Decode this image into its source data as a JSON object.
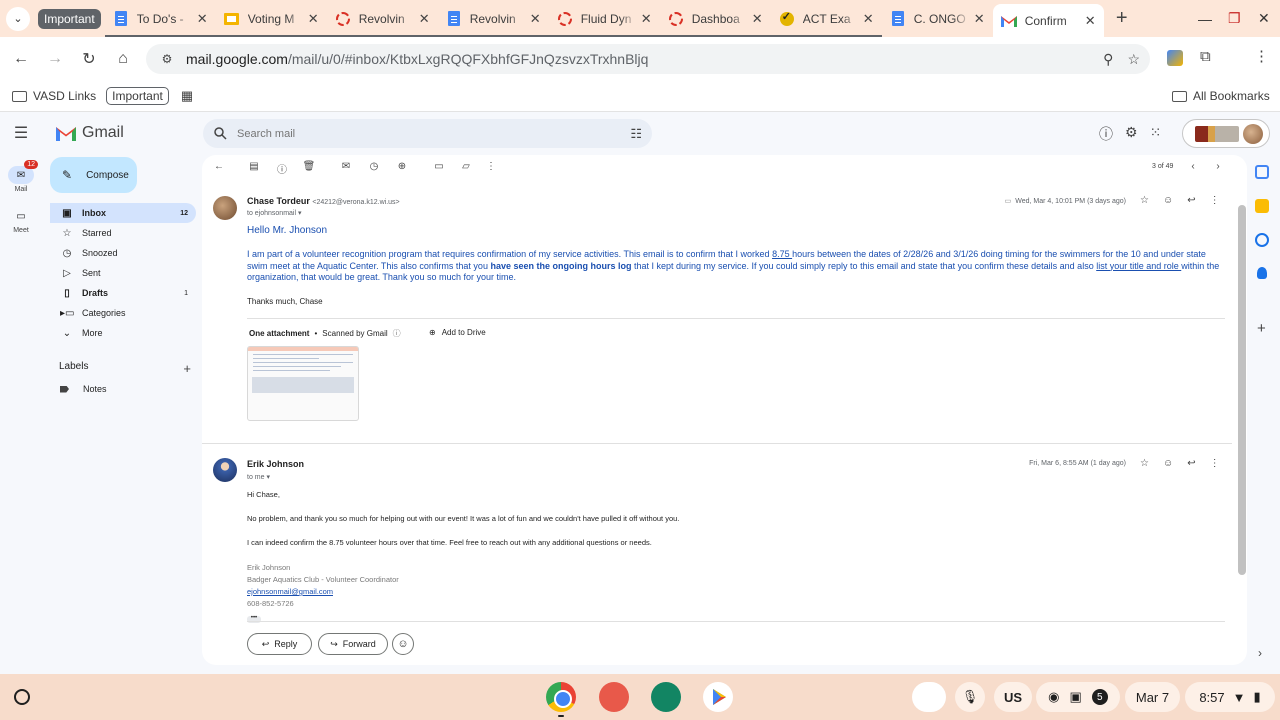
{
  "browser": {
    "tab_group_label": "Important",
    "tabs": [
      {
        "title": "To Do's - ",
        "icon": "doc-icon"
      },
      {
        "title": "Voting M",
        "icon": "slides-icon"
      },
      {
        "title": "Revolvin",
        "icon": "ring-icon"
      },
      {
        "title": "Revolvin",
        "icon": "doc-icon"
      },
      {
        "title": "Fluid Dyn",
        "icon": "ring-icon"
      },
      {
        "title": "Dashboa",
        "icon": "ring-icon"
      },
      {
        "title": "ACT Exa",
        "icon": "check-icon"
      },
      {
        "title": "C. ONGO",
        "icon": "doc-icon"
      },
      {
        "title": "Confirm",
        "icon": "gmail-icon"
      }
    ],
    "url_host": "mail.google.com",
    "url_path": "/mail/u/0/#inbox/KtbxLxgRQQFXbhfGFJnQzsvzxTrxhnBljq"
  },
  "bookmarks": {
    "vasd": "VASD Links",
    "important": "Important",
    "all": "All Bookmarks"
  },
  "gmail": {
    "brand": "Gmail",
    "search_placeholder": "Search mail",
    "rail": {
      "mail_label": "Mail",
      "mail_badge": "12",
      "meet_label": "Meet"
    },
    "compose": "Compose",
    "nav": [
      {
        "label": "Inbox",
        "count": "12",
        "icon": "inbox-icon"
      },
      {
        "label": "Starred",
        "count": "",
        "icon": "star-icon"
      },
      {
        "label": "Snoozed",
        "count": "",
        "icon": "clock-icon"
      },
      {
        "label": "Sent",
        "count": "",
        "icon": "send-icon"
      },
      {
        "label": "Drafts",
        "count": "1",
        "icon": "draft-icon"
      },
      {
        "label": "Categories",
        "count": "",
        "icon": "label-icon"
      },
      {
        "label": "More",
        "count": "",
        "icon": "chevron-down-icon"
      }
    ],
    "labels_header": "Labels",
    "labels": [
      {
        "label": "Notes"
      }
    ],
    "pager": "3 of 49"
  },
  "thread": {
    "msg1": {
      "sender": "Chase Tordeur",
      "address": "<24212@verona.k12.wi.us>",
      "to": "to ejohnsonmail",
      "date": "Wed, Mar 4, 10:01 PM (3 days ago)",
      "greeting": "Hello Mr. Jhonson",
      "p_a": "I am part of a volunteer recognition program that requires confirmation of my service activities. This email is to confirm that I worked ",
      "p_hours": "8.75 ",
      "p_b": "hours between the dates of 2/28/26 and 3/1/26 doing timing for the swimmers for the 10 and under state swim meet at the Aquatic Center. This also confirms that you ",
      "p_bold": "have seen the ongoing hours log",
      "p_c": " that I kept during my service. If you could simply reply to this email and state that you confirm these details and also ",
      "p_link": "list your title and role ",
      "p_d": "within the organization, that would be great.  Thank you so much for your time.",
      "thanks": "Thanks much, Chase",
      "attach_count": "One attachment",
      "attach_sep": "•",
      "attach_scan": "Scanned by Gmail",
      "add_drive": "Add to Drive"
    },
    "msg2": {
      "sender": "Erik Johnson",
      "to": "to me",
      "date": "Fri, Mar 6, 8:55 AM (1 day ago)",
      "greeting": "Hi Chase,",
      "line1": "No problem, and thank you so much for helping out with our event!  It was a lot of fun and we couldn't have pulled it off without you.",
      "line2": "I can indeed confirm the 8.75 volunteer hours over that time.  Feel free to reach out with any additional questions or needs.",
      "sig_name": "Erik Johnson",
      "sig_title": "Badger Aquatics Club - Volunteer Coordinator",
      "sig_email": "ejohnsonmail@gmail.com",
      "sig_phone": "608-852-5726"
    },
    "reply": "Reply",
    "forward": "Forward"
  },
  "shelf": {
    "ime": "US",
    "notif_count": "5",
    "date": "Mar 7",
    "time": "8:57"
  }
}
